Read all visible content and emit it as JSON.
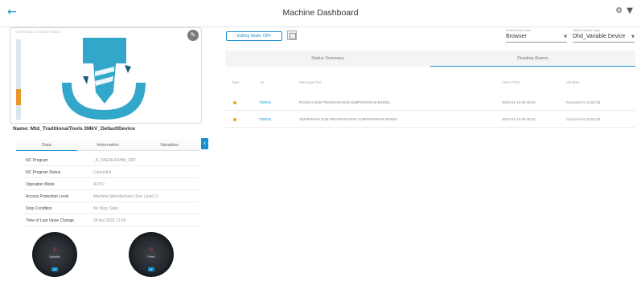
{
  "header": {
    "title": "Machine Dashboard",
    "back_icon": "←",
    "settings_icon": "⚙",
    "filter_icon": "▼"
  },
  "machine": {
    "card_caption": "UNIVERSAL TOOLING RANGE",
    "name": "Name: Mtd_TraditionalTools 3MkV_DefaultDevice"
  },
  "left_tabs": [
    "Data",
    "Information",
    "Variables"
  ],
  "details": [
    {
      "key": "NC Program",
      "value": "_N_DXENLRAHM_SPF"
    },
    {
      "key": "NC Program Status",
      "value": "Cancelled"
    },
    {
      "key": "Operation Mode",
      "value": "AUTO"
    },
    {
      "key": "Access Protection Level",
      "value": "Machine Manufacturer (Dev Level 1)"
    },
    {
      "key": "Stop Condition",
      "value": "No Stop State"
    },
    {
      "key": "Time of Last Value Change",
      "value": "29 Apr 2022 11:56"
    }
  ],
  "dials": [
    {
      "label": "Spindle",
      "value": "0",
      "zero": "0"
    },
    {
      "label": "Feed",
      "value": "0",
      "zero": "0"
    }
  ],
  "toolbar": {
    "edit_label": "Editing Mode: OFF"
  },
  "selects": {
    "time_zone": {
      "label": "Select Time Zone",
      "value": "Browser"
    },
    "device": {
      "label": "Select Device Type",
      "value": "Dhd_Variable Device"
    }
  },
  "right_tabs": [
    "Status Summary",
    "Pending Alarms"
  ],
  "table": {
    "headers": [
      "Type",
      "ID",
      "Message Text",
      "Alarm Time",
      "Variable"
    ],
    "rows": [
      {
        "id": "700015",
        "message": "ROUGH SUB-PROGRAM END SUBPROGRAM MODEL",
        "time": "2022-04-12 09:46:32",
        "variable": "Occurred At 11:53:33"
      },
      {
        "id": "700015",
        "message": "SEMIFINISH SUB-PROGRAM END SUBPROGRAM MODEL",
        "time": "2022-04-15 09:46:32",
        "variable": "Occurred At 11:53:33"
      }
    ]
  },
  "colors": {
    "accent": "#1a8fd0",
    "warning": "#f0a21c",
    "gauge": "#e8962e"
  }
}
